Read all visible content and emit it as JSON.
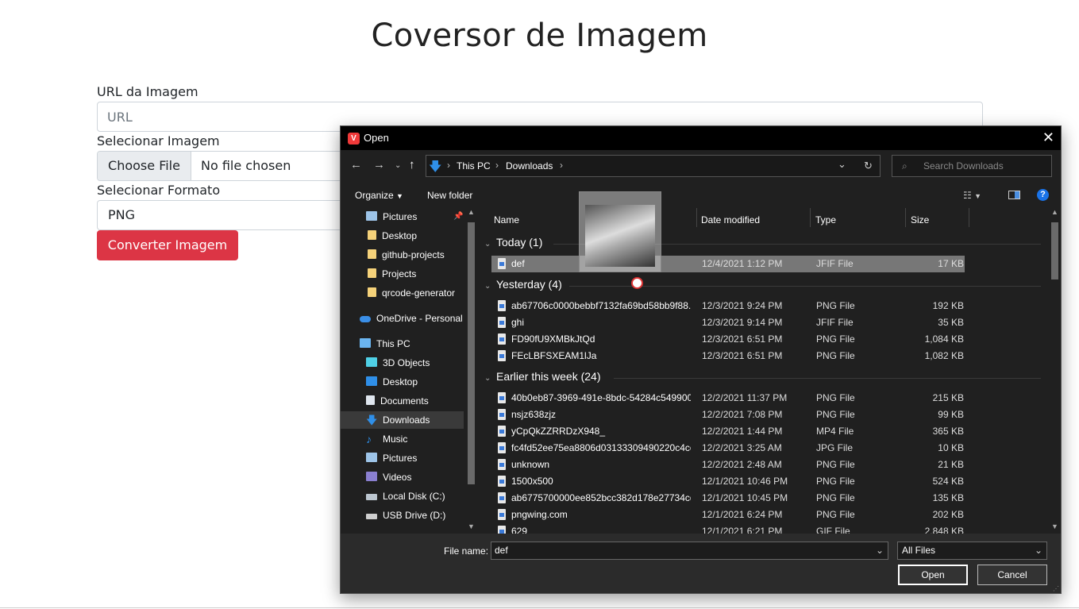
{
  "page": {
    "title": "Coversor de Imagem",
    "url_label": "URL da Imagem",
    "url_placeholder": "URL",
    "select_image_label": "Selecionar Imagem",
    "choose_file_button": "Choose File",
    "no_file_text": "No file chosen",
    "select_format_label": "Selecionar Formato",
    "format_value": "PNG",
    "convert_button": "Converter Imagem",
    "accent_color": "#dc3545"
  },
  "dialog": {
    "title": "Open",
    "breadcrumb": [
      "This PC",
      "Downloads"
    ],
    "search_placeholder": "Search Downloads",
    "toolbar": {
      "organize": "Organize",
      "new_folder": "New folder"
    },
    "nav_tree": [
      {
        "label": "Pictures",
        "icon": "pictures-icon"
      },
      {
        "label": "Desktop",
        "icon": "folder-icon"
      },
      {
        "label": "github-projects",
        "icon": "folder-icon"
      },
      {
        "label": "Projects",
        "icon": "folder-icon"
      },
      {
        "label": "qrcode-generator",
        "icon": "folder-icon"
      },
      {
        "label": "OneDrive - Personal",
        "icon": "onedrive-icon"
      },
      {
        "label": "This PC",
        "icon": "computer-icon"
      },
      {
        "label": "3D Objects",
        "icon": "3d-objects-icon"
      },
      {
        "label": "Desktop",
        "icon": "desktop-icon"
      },
      {
        "label": "Documents",
        "icon": "documents-icon"
      },
      {
        "label": "Downloads",
        "icon": "downloads-icon",
        "selected": true
      },
      {
        "label": "Music",
        "icon": "music-icon"
      },
      {
        "label": "Pictures",
        "icon": "pictures-icon"
      },
      {
        "label": "Videos",
        "icon": "videos-icon"
      },
      {
        "label": "Local Disk (C:)",
        "icon": "disk-icon"
      },
      {
        "label": "USB Drive (D:)",
        "icon": "usb-drive-icon"
      }
    ],
    "columns": {
      "name": "Name",
      "date": "Date modified",
      "type": "Type",
      "size": "Size"
    },
    "groups": [
      {
        "label": "Today (1)",
        "files": [
          {
            "name": "def",
            "date": "12/4/2021 1:12 PM",
            "type": "JFIF File",
            "size": "17 KB",
            "selected": true
          }
        ]
      },
      {
        "label": "Yesterday (4)",
        "files": [
          {
            "name": "ab67706c0000bebbf7132fa69bd58bb9f88...",
            "date": "12/3/2021 9:24 PM",
            "type": "PNG File",
            "size": "192 KB"
          },
          {
            "name": "ghi",
            "date": "12/3/2021 9:14 PM",
            "type": "JFIF File",
            "size": "35 KB"
          },
          {
            "name": "FD90fU9XMBkJtQd",
            "date": "12/3/2021 6:51 PM",
            "type": "PNG File",
            "size": "1,084 KB"
          },
          {
            "name": "FEcLBFSXEAM1lJa",
            "date": "12/3/2021 6:51 PM",
            "type": "PNG File",
            "size": "1,082 KB"
          }
        ]
      },
      {
        "label": "Earlier this week (24)",
        "files": [
          {
            "name": "40b0eb87-3969-491e-8bdc-54284c549900",
            "date": "12/2/2021 11:37 PM",
            "type": "PNG File",
            "size": "215 KB"
          },
          {
            "name": "nsjz638zjz",
            "date": "12/2/2021 7:08 PM",
            "type": "PNG File",
            "size": "99 KB"
          },
          {
            "name": "yCpQkZZRRDzX948_",
            "date": "12/2/2021 1:44 PM",
            "type": "MP4 File",
            "size": "365 KB"
          },
          {
            "name": "fc4fd52ee75ea8806d03133309490220c4cc...",
            "date": "12/2/2021 3:25 AM",
            "type": "JPG File",
            "size": "10 KB"
          },
          {
            "name": "unknown",
            "date": "12/2/2021 2:48 AM",
            "type": "PNG File",
            "size": "21 KB"
          },
          {
            "name": "1500x500",
            "date": "12/1/2021 10:46 PM",
            "type": "PNG File",
            "size": "524 KB"
          },
          {
            "name": "ab6775700000ee852bcc382d178e27734cd...",
            "date": "12/1/2021 10:45 PM",
            "type": "PNG File",
            "size": "135 KB"
          },
          {
            "name": "pngwing.com",
            "date": "12/1/2021 6:24 PM",
            "type": "PNG File",
            "size": "202 KB"
          },
          {
            "name": "629",
            "date": "12/1/2021 6:21 PM",
            "type": "GIF File",
            "size": "2,848 KB"
          }
        ]
      }
    ],
    "file_name_label": "File name:",
    "file_name_value": "def",
    "file_type_value": "All Files",
    "open_button": "Open",
    "cancel_button": "Cancel"
  }
}
